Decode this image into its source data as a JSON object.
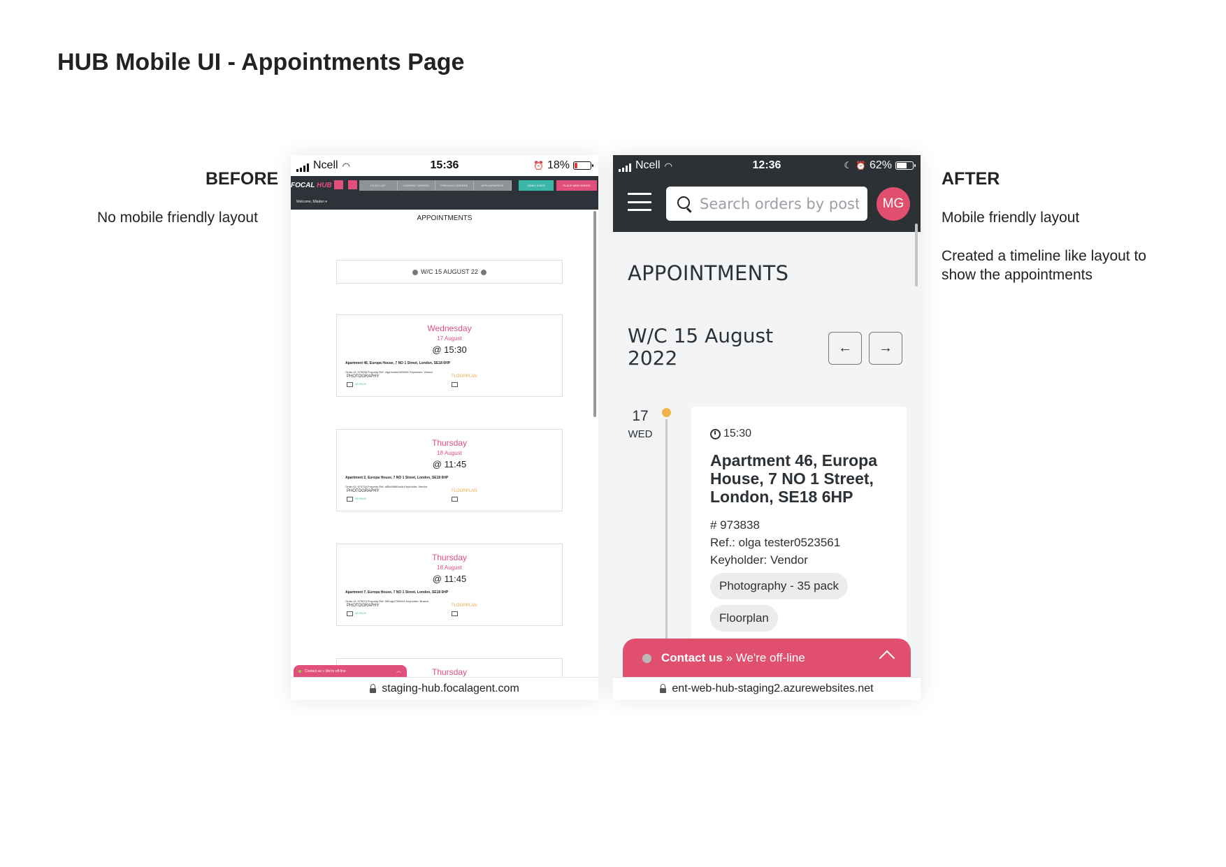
{
  "page": {
    "title": "HUB Mobile UI - Appointments Page"
  },
  "before": {
    "heading": "BEFORE",
    "description": "No mobile friendly layout",
    "status": {
      "carrier": "Ncell",
      "time": "15:36",
      "battery": "18%"
    },
    "nav": {
      "logo_a": "FOCAL",
      "logo_b": "HUB",
      "tabs": [
        "TO DO LIST",
        "CURRENT ORDERS",
        "PREVIOUS ORDERS",
        "APPOINTMENTS"
      ],
      "video_stats": "VIDEO STATS",
      "place_order": "PLACE NEW ORDER",
      "welcome": "Welcome, Mladen ▾"
    },
    "title": "APPOINTMENTS",
    "week": "W/C 15 AUGUST 22",
    "cards": [
      {
        "day": "Wednesday",
        "date": "17 August",
        "time": "@ 15:30",
        "address": "Apartment 46, Europa House, 7 NO 1 Street, London, SE18 6HP",
        "meta": "Order ID: 973838   Property Ref: olga tester0523561   Keyholder: Vendor",
        "photo": "PHOTOGRAPHY",
        "floor": "FLOORPLAN",
        "pack": "35 PACK"
      },
      {
        "day": "Thursday",
        "date": "18 August",
        "time": "@ 11:45",
        "address": "Apartment 2, Europa House, 7 NO 1 Street, London, SE18 6HP",
        "meta": "Order ID: 973734   Property Ref: a55c59849a4a   Keyholder: Vendor",
        "photo": "PHOTOGRAPHY",
        "floor": "FLOORPLAN",
        "pack": "35 PACK"
      },
      {
        "day": "Thursday",
        "date": "18 August",
        "time": "@ 11:45",
        "address": "Apartment 7, Europa House, 7 NO 1 Street, London, SE18 6HP",
        "meta": "Order ID: 973674   Property Ref: 59Eogd7305W3   Keyholder: Branch",
        "photo": "PHOTOGRAPHY",
        "floor": "FLOORPLAN",
        "pack": "35 PACK"
      },
      {
        "day": "Thursday"
      }
    ],
    "chat": "Contact us » We're off-line",
    "url": "staging-hub.focalagent.com"
  },
  "after": {
    "heading": "AFTER",
    "description_1": "Mobile friendly layout",
    "description_2": "Created a timeline like layout to show the appointments",
    "status": {
      "carrier": "Ncell",
      "time": "12:36",
      "battery": "62%"
    },
    "search_placeholder": "Search orders by postcode",
    "avatar": "MG",
    "title": "APPOINTMENTS",
    "week": "W/C 15 August 2022",
    "prev_label": "←",
    "next_label": "→",
    "appointment": {
      "day_number": "17",
      "day_name": "WED",
      "time": "15:30",
      "address": "Apartment 46, Europa House, 7 NO 1 Street, London, SE18 6HP",
      "order": "# 973838",
      "ref": "Ref.: olga tester0523561",
      "keyholder": "Keyholder: Vendor",
      "services": [
        "Photography - 35 pack",
        "Floorplan"
      ]
    },
    "chat": {
      "contact": "Contact us",
      "separator": "»",
      "status": "We're off-line"
    },
    "url": "ent-web-hub-staging2.azurewebsites.net"
  },
  "colors": {
    "brand_pink": "#e0506e",
    "header_dark": "#2c3136",
    "timeline_dot": "#f0b54a",
    "accent_teal": "#3bb7a9"
  }
}
